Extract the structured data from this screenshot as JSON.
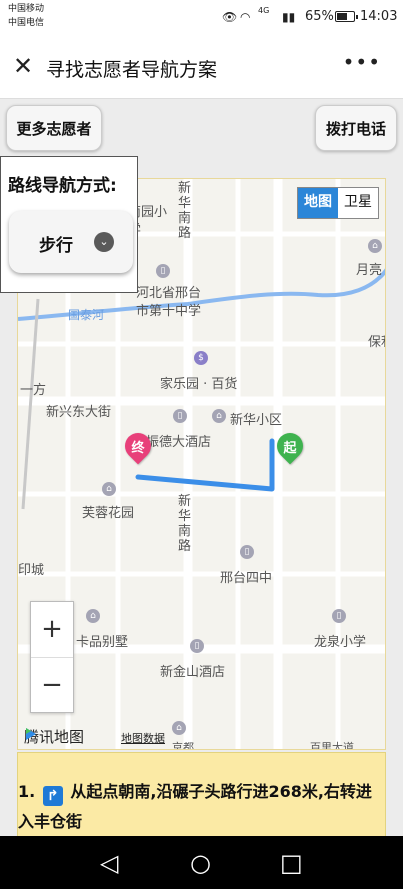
{
  "status": {
    "carrier1": "中国移动",
    "carrier2": "中国电信",
    "signal": "4G",
    "battery_text": "65%",
    "battery_level": 0.65,
    "time": "14:03"
  },
  "header": {
    "title": "寻找志愿者导航方案",
    "close_icon": "close-icon",
    "more_icon": "more-icon"
  },
  "actions": {
    "more_volunteers": "更多志愿者",
    "call": "拨打电话"
  },
  "route_panel": {
    "label": "路线导航方式:",
    "mode": "步行"
  },
  "map": {
    "type_map": "地图",
    "type_satellite": "卫星",
    "labels": {
      "xinhua_north": "新华南路",
      "xinhua_south": "新华南路",
      "nanyuan": "南园小学",
      "yueliang": "月亮",
      "hebei": "河北省邢台市第十中学",
      "guotai": "国泰河",
      "baoli": "保利",
      "jiale": "家乐园 · 百货",
      "yifang": "一方",
      "xinxing": "新兴东大街",
      "xinhua_xiaoqu": "新华小区",
      "zhende": "振德大酒店",
      "furong": "芙蓉花园",
      "yincheng": "印城",
      "xingtai4": "邢台四中",
      "pinbieshu": "卡品别墅",
      "longquan": "龙泉小学",
      "jinshan": "新金山酒店",
      "jingdu": "京都",
      "baichen": "百里大道"
    },
    "start_label": "起",
    "end_label": "终",
    "brand": "腾讯地图",
    "data_link": "地图数据",
    "zoom_in": "+",
    "zoom_out": "−",
    "route_color": "#3b8ee8"
  },
  "step": {
    "number": "1.",
    "text": "从起点朝南,沿碾子头路行进268米,右转进入丰仓街"
  },
  "navbar": {
    "back": "◁",
    "home": "○",
    "recents": "□"
  }
}
